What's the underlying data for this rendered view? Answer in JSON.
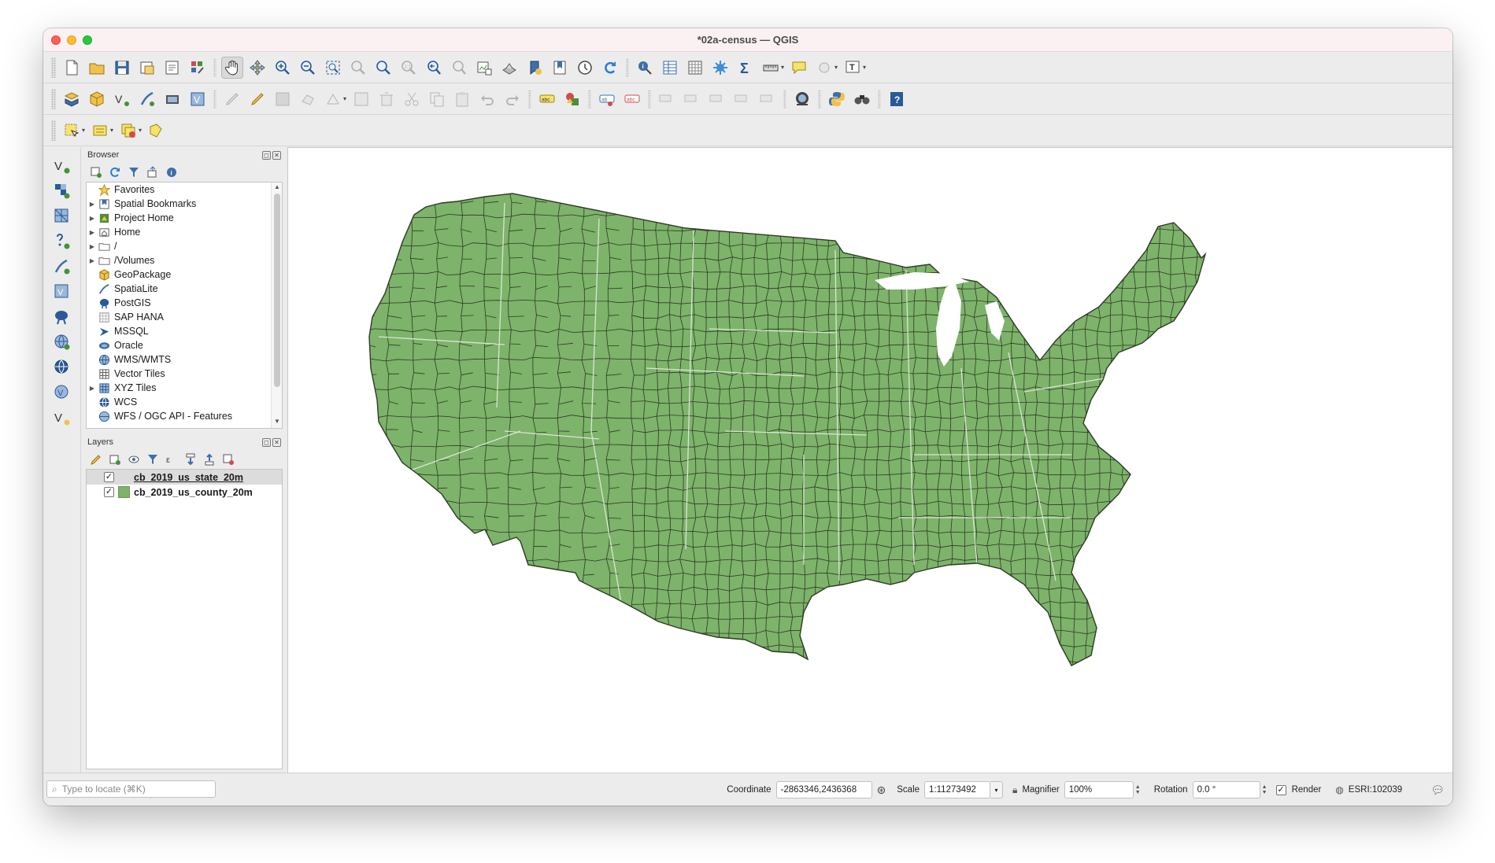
{
  "window": {
    "title": "*02a-census — QGIS"
  },
  "toolbars": {
    "file": [
      "new-project-icon",
      "open-project-icon",
      "save-project-icon",
      "new-print-layout-icon",
      "layout-manager-icon",
      "style-manager-icon"
    ],
    "navigation": [
      "pan-map-icon",
      "pan-to-selection-icon",
      "zoom-in-icon",
      "zoom-out-icon",
      "zoom-full-icon",
      "zoom-to-selection-icon",
      "zoom-to-layer-icon",
      "zoom-native-icon",
      "zoom-last-icon",
      "zoom-next-icon",
      "new-map-view-icon",
      "new-3d-view-icon",
      "new-bookmark-icon",
      "show-bookmarks-icon",
      "temporal-controller-icon",
      "refresh-icon"
    ],
    "attributes": [
      "identify-icon",
      "attribute-table-icon",
      "field-calculator-icon",
      "processing-toolbox-icon",
      "statistics-icon",
      "measure-icon",
      "map-tips-icon",
      "select-by-location-icon",
      "text-annotation-icon"
    ]
  },
  "browser": {
    "title": "Browser",
    "items": [
      {
        "label": "Favorites",
        "icon": "star-icon",
        "expandable": false
      },
      {
        "label": "Spatial Bookmarks",
        "icon": "bookmark-icon",
        "expandable": true
      },
      {
        "label": "Project Home",
        "icon": "project-home-icon",
        "expandable": true
      },
      {
        "label": "Home",
        "icon": "home-icon",
        "expandable": true
      },
      {
        "label": "/",
        "icon": "folder-icon",
        "expandable": true
      },
      {
        "label": "/Volumes",
        "icon": "folder-icon",
        "expandable": true
      },
      {
        "label": "GeoPackage",
        "icon": "geopackage-icon",
        "expandable": false
      },
      {
        "label": "SpatiaLite",
        "icon": "spatialite-icon",
        "expandable": false
      },
      {
        "label": "PostGIS",
        "icon": "postgis-icon",
        "expandable": false
      },
      {
        "label": "SAP HANA",
        "icon": "sap-hana-icon",
        "expandable": false
      },
      {
        "label": "MSSQL",
        "icon": "mssql-icon",
        "expandable": false
      },
      {
        "label": "Oracle",
        "icon": "oracle-icon",
        "expandable": false
      },
      {
        "label": "WMS/WMTS",
        "icon": "wms-icon",
        "expandable": false
      },
      {
        "label": "Vector Tiles",
        "icon": "vector-tiles-icon",
        "expandable": false
      },
      {
        "label": "XYZ Tiles",
        "icon": "xyz-tiles-icon",
        "expandable": true
      },
      {
        "label": "WCS",
        "icon": "wcs-icon",
        "expandable": false
      },
      {
        "label": "WFS / OGC API - Features",
        "icon": "wfs-icon",
        "expandable": false
      }
    ]
  },
  "layers": {
    "title": "Layers",
    "items": [
      {
        "name": "cb_2019_us_state_20m",
        "checked": true,
        "selected": true,
        "swatch": "none"
      },
      {
        "name": "cb_2019_us_county_20m",
        "checked": true,
        "selected": false,
        "swatch": "#7db36a"
      }
    ]
  },
  "map": {
    "fill_color": "#7db36a",
    "county_line_color": "#2d3b24",
    "state_line_color": "#d9e6d3"
  },
  "status": {
    "locator_placeholder": "Type to locate (⌘K)",
    "coordinate_label": "Coordinate",
    "coordinate_value": "-2863346,2436368",
    "scale_label": "Scale",
    "scale_value": "1:11273492",
    "magnifier_label": "Magnifier",
    "magnifier_value": "100%",
    "rotation_label": "Rotation",
    "rotation_value": "0.0 °",
    "render_label": "Render",
    "render_checked": true,
    "crs_value": "ESRI:102039"
  }
}
